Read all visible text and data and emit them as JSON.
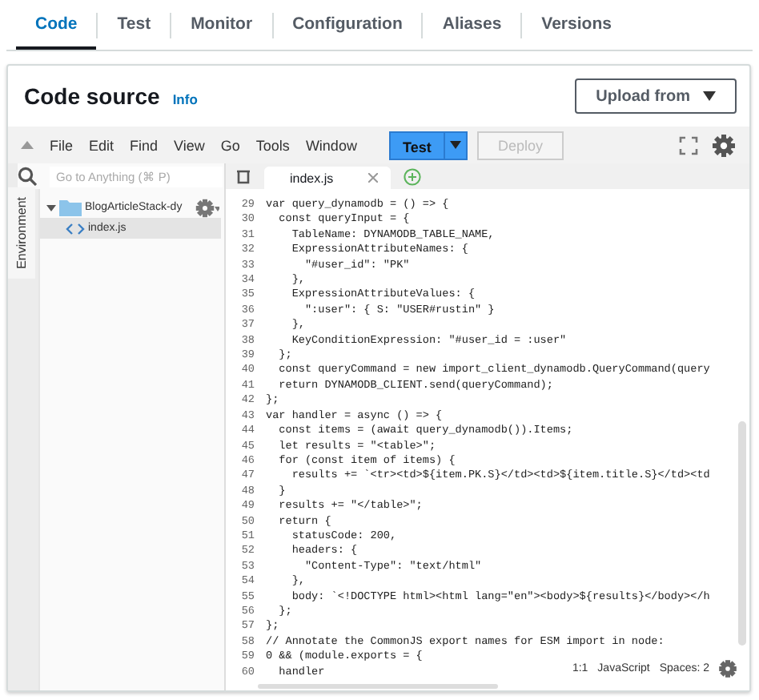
{
  "tabs": [
    {
      "label": "Code",
      "selected": true
    },
    {
      "label": "Test",
      "selected": false
    },
    {
      "label": "Monitor",
      "selected": false
    },
    {
      "label": "Configuration",
      "selected": false
    },
    {
      "label": "Aliases",
      "selected": false
    },
    {
      "label": "Versions",
      "selected": false
    }
  ],
  "section": {
    "title": "Code source",
    "info_link": "Info",
    "upload_button": "Upload from"
  },
  "toolbar": {
    "menu": [
      "File",
      "Edit",
      "Find",
      "View",
      "Go",
      "Tools",
      "Window"
    ],
    "run_button": "Test",
    "deploy_button": {
      "label": "Deploy",
      "disabled": true
    }
  },
  "search": {
    "placeholder": "Go to Anything (⌘ P)"
  },
  "environment_label": "Environment",
  "tree": [
    {
      "label": "BlogArticleStack-dy",
      "kind": "folder",
      "expanded": true,
      "selected": false,
      "children": [
        {
          "label": "index.js",
          "kind": "file",
          "selected": true
        }
      ]
    }
  ],
  "editor_tabs": [
    {
      "label": "index.js",
      "selected": true
    }
  ],
  "code_lines": [
    {
      "number": "29",
      "text": "var query_dynamodb = () => {"
    },
    {
      "number": "30",
      "text": "  const queryInput = {"
    },
    {
      "number": "31",
      "text": "    TableName: DYNAMODB_TABLE_NAME,"
    },
    {
      "number": "32",
      "text": "    ExpressionAttributeNames: {"
    },
    {
      "number": "33",
      "text": "      \"#user_id\": \"PK\""
    },
    {
      "number": "34",
      "text": "    },"
    },
    {
      "number": "35",
      "text": "    ExpressionAttributeValues: {"
    },
    {
      "number": "36",
      "text": "      \":user\": { S: \"USER#rustin\" }"
    },
    {
      "number": "37",
      "text": "    },"
    },
    {
      "number": "38",
      "text": "    KeyConditionExpression: \"#user_id = :user\""
    },
    {
      "number": "39",
      "text": "  };"
    },
    {
      "number": "40",
      "text": "  const queryCommand = new import_client_dynamodb.QueryCommand(query"
    },
    {
      "number": "41",
      "text": "  return DYNAMODB_CLIENT.send(queryCommand);"
    },
    {
      "number": "42",
      "text": "};"
    },
    {
      "number": "43",
      "text": "var handler = async () => {"
    },
    {
      "number": "44",
      "text": "  const items = (await query_dynamodb()).Items;"
    },
    {
      "number": "45",
      "text": "  let results = \"<table>\";"
    },
    {
      "number": "46",
      "text": "  for (const item of items) {"
    },
    {
      "number": "47",
      "text": "    results += `<tr><td>${item.PK.S}</td><td>${item.title.S}</td><td"
    },
    {
      "number": "48",
      "text": "  }"
    },
    {
      "number": "49",
      "text": "  results += \"</table>\";"
    },
    {
      "number": "50",
      "text": "  return {"
    },
    {
      "number": "51",
      "text": "    statusCode: 200,"
    },
    {
      "number": "52",
      "text": "    headers: {"
    },
    {
      "number": "53",
      "text": "      \"Content-Type\": \"text/html\""
    },
    {
      "number": "54",
      "text": "    },"
    },
    {
      "number": "55",
      "text": "    body: `<!DOCTYPE html><html lang=\"en\"><body>${results}</body></h"
    },
    {
      "number": "56",
      "text": "  };"
    },
    {
      "number": "57",
      "text": "};"
    },
    {
      "number": "58",
      "text": "// Annotate the CommonJS export names for ESM import in node:"
    },
    {
      "number": "59",
      "text": "0 && (module.exports = {"
    },
    {
      "number": "60",
      "text": "  handler"
    }
  ],
  "status": {
    "position": "1:1",
    "language": "JavaScript",
    "indent": "Spaces: 2"
  }
}
